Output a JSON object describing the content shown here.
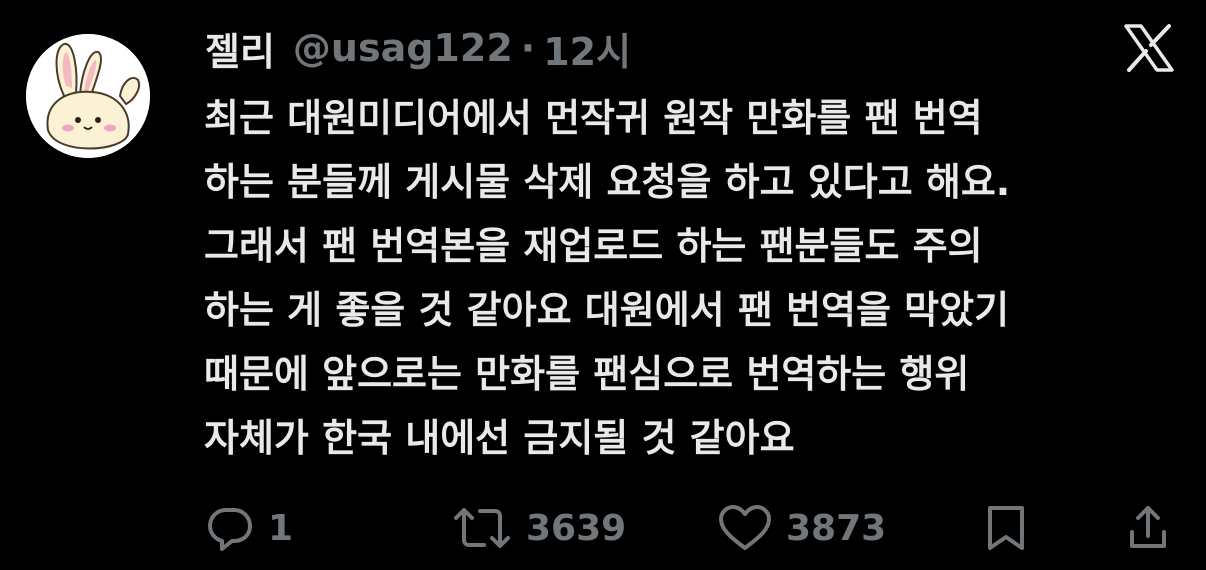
{
  "tweet": {
    "display_name": "젤리",
    "handle": "@usag122",
    "separator": "·",
    "time": "12시",
    "text_lines": [
      "최근 대원미디어에서 먼작귀 원작 만화를 팬 번역",
      "하는 분들께 게시물 삭제 요청을 하고 있다고 해요.",
      "그래서 팬 번역본을 재업로드 하는 팬분들도 주의",
      "하는 게 좋을 것 같아요 대원에서 팬 번역을 막았기",
      "때문에 앞으로는 만화를 팬심으로 번역하는 행위",
      "자체가 한국 내에선 금지될 것 같아요"
    ]
  },
  "actions": {
    "reply_count": "1",
    "retweet_count": "3639",
    "like_count": "3873"
  },
  "icons": {
    "avatar": "bunny-avatar",
    "platform": "x-logo-icon",
    "reply": "reply-icon",
    "retweet": "retweet-icon",
    "like": "heart-icon",
    "bookmark": "bookmark-icon",
    "share": "share-icon"
  },
  "colors": {
    "background": "#000000",
    "text": "#e7e9ea",
    "secondary": "#71767b"
  }
}
